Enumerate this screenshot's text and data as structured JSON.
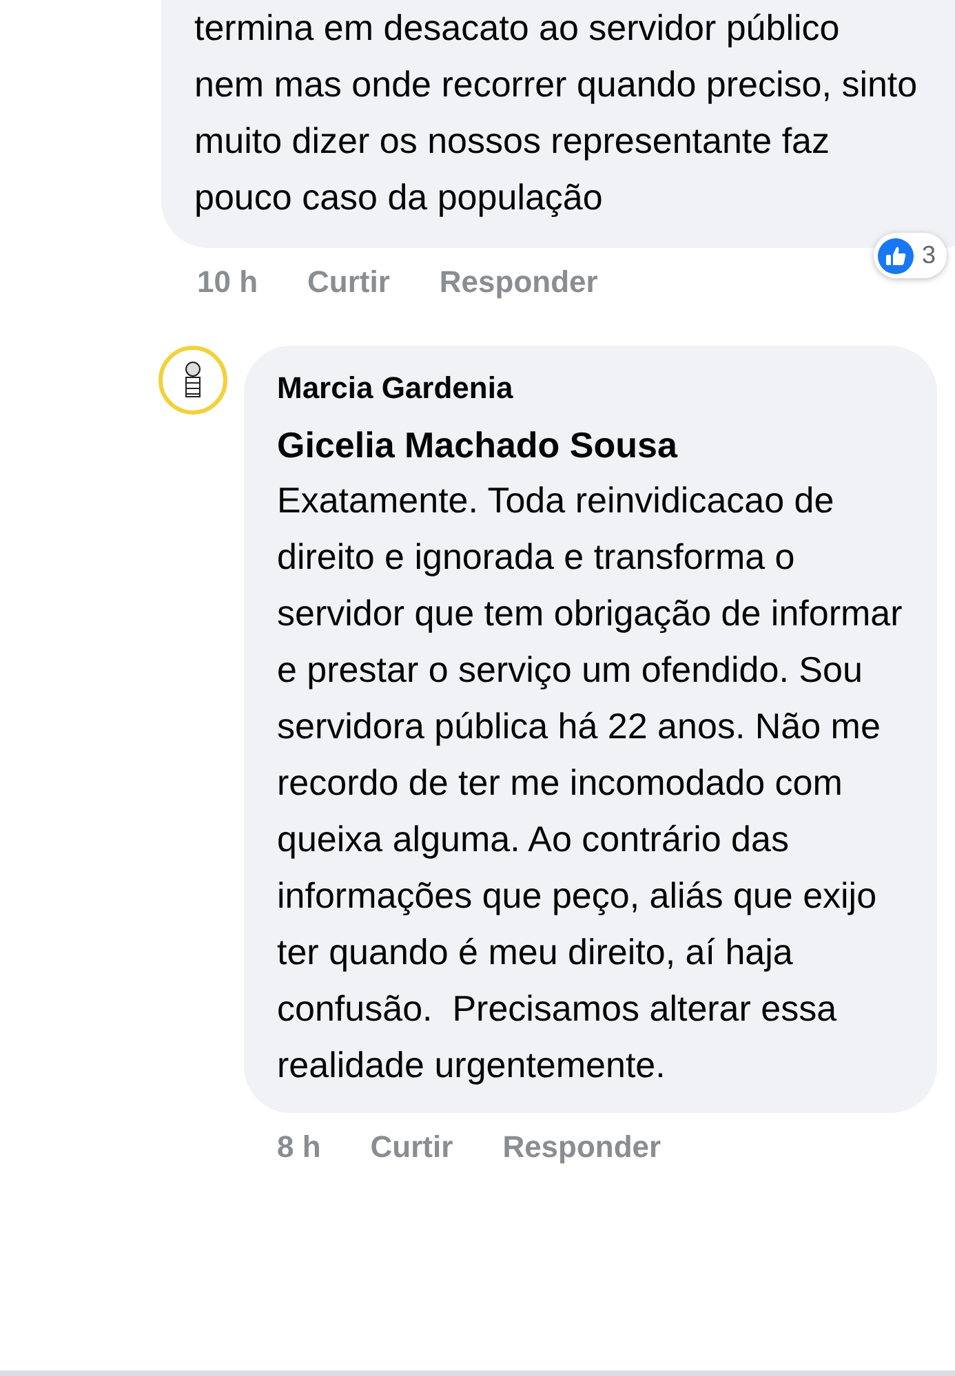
{
  "comments": [
    {
      "text": "termina em desacato ao servidor público nem mas onde recorrer quando preciso, sinto muito dizer os nossos representante faz pouco caso da população",
      "time": "10 h",
      "actions": [
        "Curtir",
        "Responder"
      ],
      "reaction_count": "3"
    },
    {
      "author": "Marcia Gardenia",
      "mention": "Gicelia Machado Sousa",
      "text": "Exatamente. Toda reinvidicacao de direito e ignorada e transforma o servidor que tem obrigação de informar e prestar o serviço um ofendido. Sou servidora pública há 22 anos. Não me recordo de ter me incomodado com queixa alguma. Ao contrário das informações que peço, aliás que exijo ter quando é meu direito, aí haja confusão.  Precisamos alterar essa realidade urgentemente.",
      "time": "8 h",
      "actions": [
        "Curtir",
        "Responder"
      ]
    }
  ]
}
